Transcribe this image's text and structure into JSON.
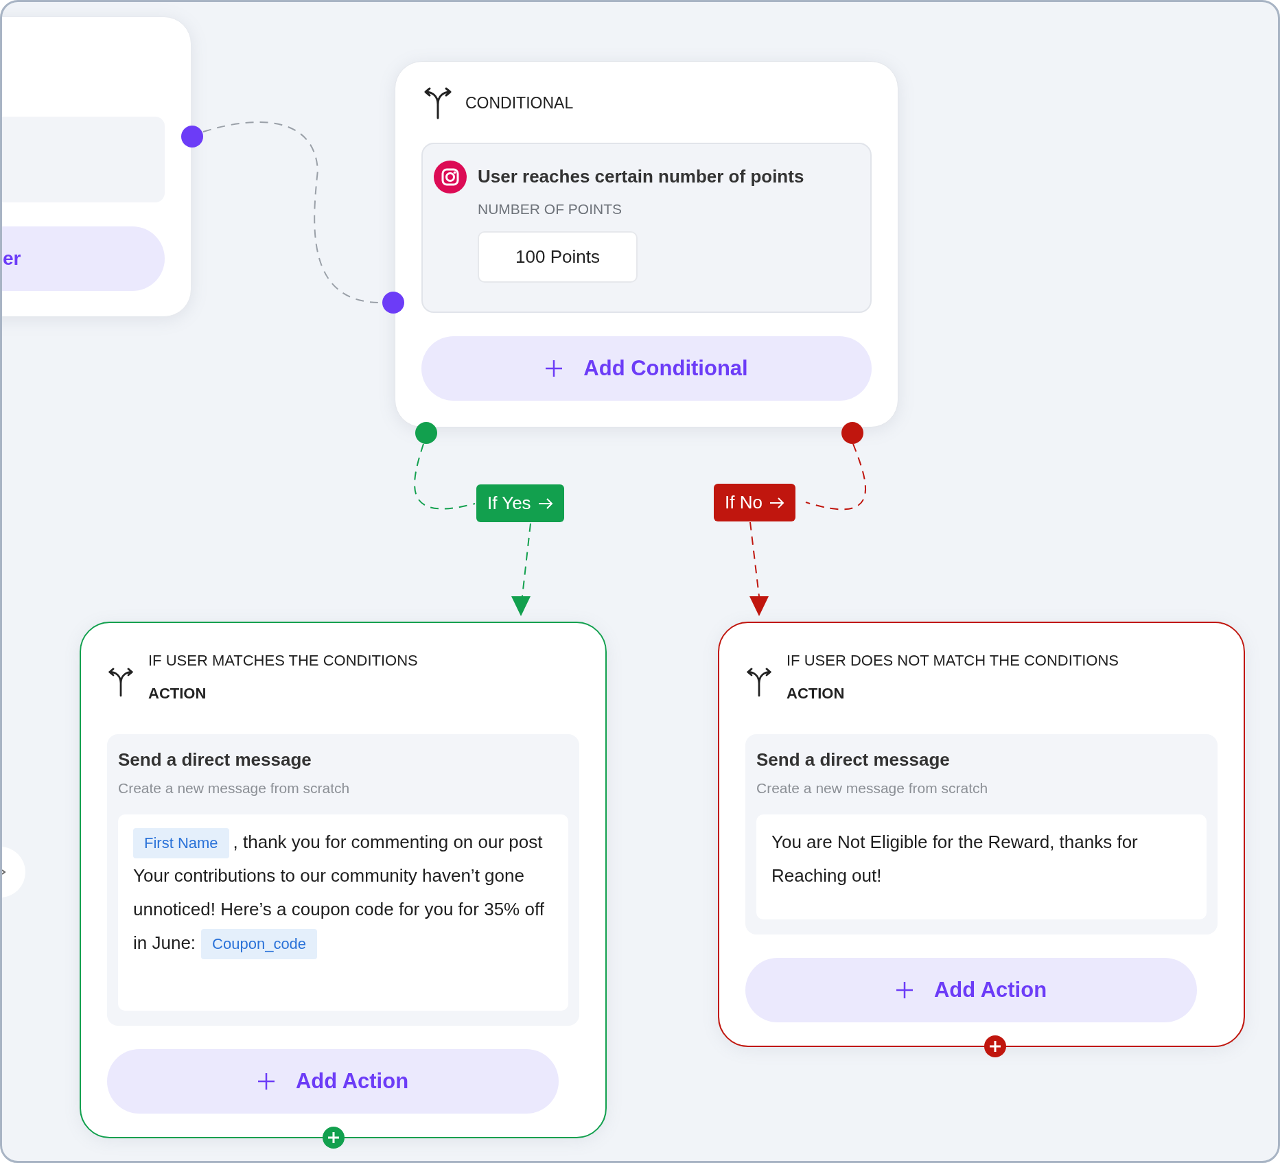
{
  "canvas": {
    "partial_node": {
      "button_label": "er"
    },
    "conditional_node": {
      "title": "CONDITIONAL",
      "trigger": {
        "title": "User reaches certain number of points",
        "field_label": "NUMBER OF POINTS",
        "value": "100 Points"
      },
      "add_button": "Add Conditional"
    },
    "branches": [
      {
        "label": "If Yes",
        "color": "#12a04e",
        "header": "IF USER MATCHES THE CONDITIONS",
        "subheader": "ACTION",
        "action": {
          "title": "Send a direct message",
          "subtitle": "Create a new message from scratch",
          "message": [
            {
              "kind": "tag",
              "text": "First Name"
            },
            {
              "kind": "text",
              "text": ", thank you for commenting on our post  Your contributions to our community haven’t gone unnoticed! Here’s a coupon code for you for 35% off in June:"
            },
            {
              "kind": "tag",
              "text": "Coupon_code"
            }
          ]
        },
        "add_button": "Add Action"
      },
      {
        "label": "If No",
        "color": "#c0160e",
        "header": "IF USER DOES NOT MATCH THE CONDITIONS",
        "subheader": "ACTION",
        "action": {
          "title": "Send a direct message",
          "subtitle": "Create a new message from scratch",
          "message": [
            {
              "kind": "text",
              "text": "You are Not Eligible for the Reward, thanks for Reaching out!"
            }
          ]
        },
        "add_button": "Add Action"
      }
    ]
  }
}
